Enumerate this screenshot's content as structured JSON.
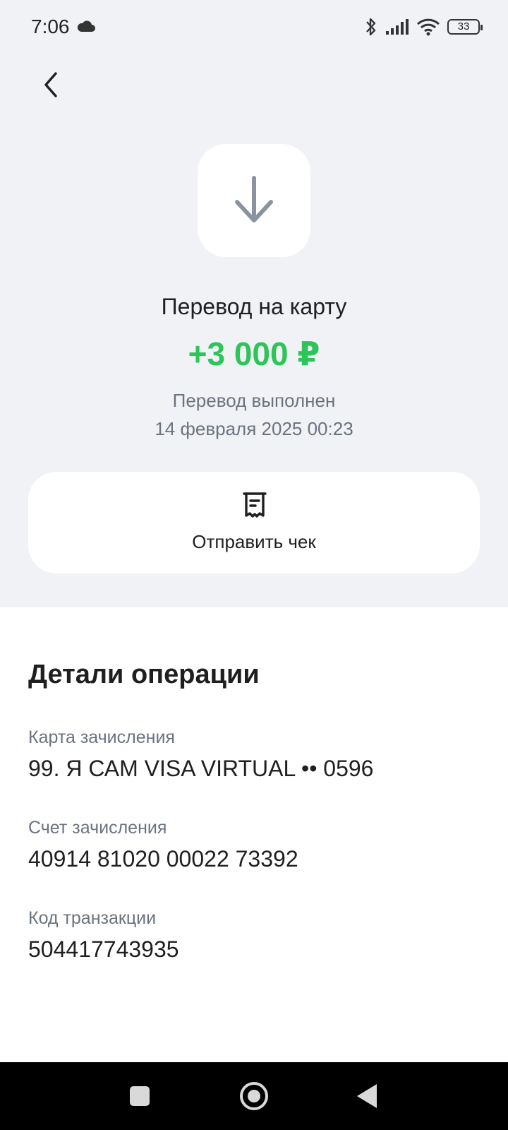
{
  "status_bar": {
    "time": "7:06",
    "battery": "33"
  },
  "header": {
    "back_icon": "chevron-left-icon"
  },
  "transaction": {
    "icon": "arrow-down-icon",
    "title": "Перевод на карту",
    "amount": "+3 000 ₽",
    "amount_color": "#2ec45a",
    "status": "Перевод выполнен",
    "datetime": "14 февраля 2025 00:23"
  },
  "actions": {
    "send_receipt_label": "Отправить чек",
    "receipt_icon": "receipt-icon"
  },
  "details": {
    "title": "Детали операции",
    "items": [
      {
        "label": "Карта зачисления",
        "value": "99. Я САМ VISA VIRTUAL •• 0596"
      },
      {
        "label": "Счет зачисления",
        "value": "40914 81020 00022 73392"
      },
      {
        "label": "Код транзакции",
        "value": "504417743935"
      }
    ]
  }
}
